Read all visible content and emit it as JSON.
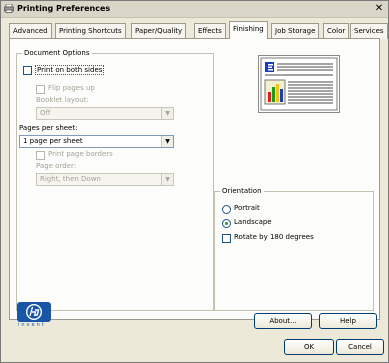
{
  "title": "Printing Preferences",
  "tabs": [
    "Advanced",
    "Printing Shortcuts",
    "Paper/Quality",
    "Effects",
    "Finishing",
    "Job Storage",
    "Color",
    "Services"
  ],
  "active_tab": "Finishing",
  "document_options": {
    "label": "Document Options",
    "print_both_sides": "Print on both sides",
    "flip_pages_up": "Flip pages up",
    "booklet_layout_label": "Booklet layout:",
    "booklet_layout_value": "Off",
    "pages_per_sheet_label": "Pages per sheet:",
    "pages_per_sheet_value": "1 page per sheet",
    "print_page_borders": "Print page borders",
    "page_order_label": "Page order:",
    "page_order_value": "Right, then Down"
  },
  "orientation": {
    "label": "Orientation",
    "portrait": "Portrait",
    "landscape": "Landscape",
    "rotate": "Rotate by 180 degrees",
    "selected": "Landscape"
  },
  "logo_text": "invent",
  "buttons": {
    "about": "About...",
    "help": "Help",
    "ok": "OK",
    "cancel": "Cancel"
  }
}
